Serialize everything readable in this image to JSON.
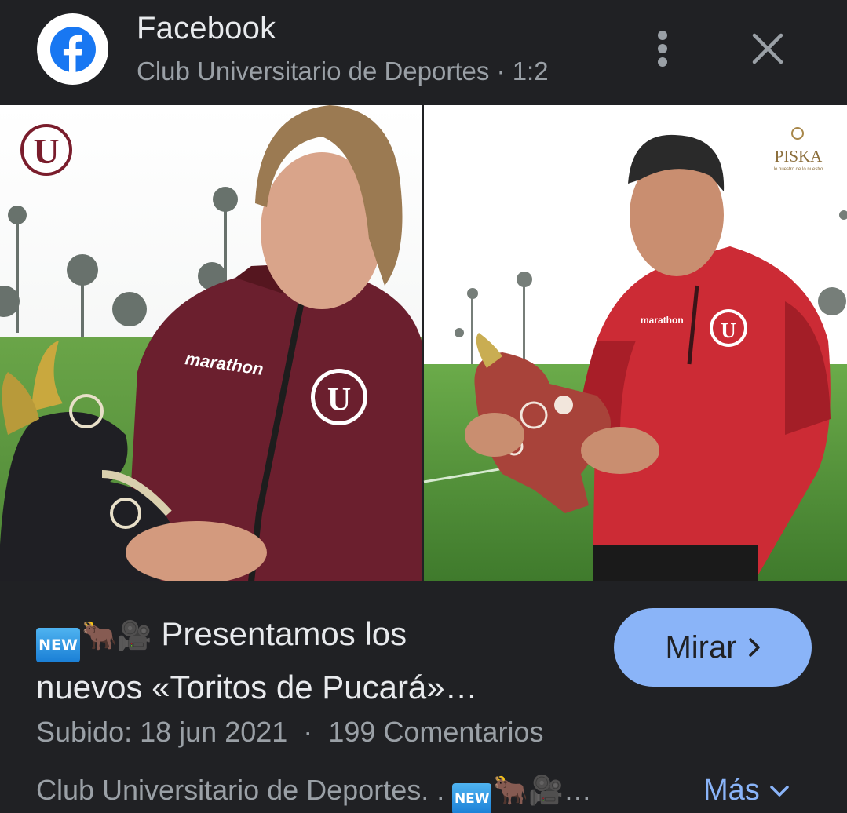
{
  "header": {
    "source_name": "Facebook",
    "subtitle": "Club Universitario de Deportes · 1:2",
    "icons": {
      "avatar": "facebook-logo",
      "more": "more-vert-icon",
      "close": "close-icon"
    }
  },
  "hero": {
    "left_watermark": "U",
    "right_brand": "PISKA",
    "right_brand_tagline": "lo nuestro de lo nuestro",
    "jacket_brand": "marathon",
    "lens_icon": "lens-icon"
  },
  "post": {
    "new_badge": "NEW",
    "emoji_bull": "🐂",
    "emoji_camera": "🎥",
    "headline_line1": "Presentamos los",
    "headline_line2": "nuevos «Toritos de Pucará»…",
    "watch_label": "Mirar",
    "meta_uploaded": "Subido: 18 jun 2021",
    "meta_separator": "·",
    "meta_comments": "199 Comentarios",
    "description": "Club Universitario de Deportes. .",
    "description_trail": "…",
    "more_label": "Más"
  },
  "colors": {
    "background": "#202124",
    "accent": "#8ab4f8",
    "facebook_blue": "#1877f2",
    "maroon_jacket": "#6b1f2e",
    "red_jacket": "#cc2b35"
  }
}
